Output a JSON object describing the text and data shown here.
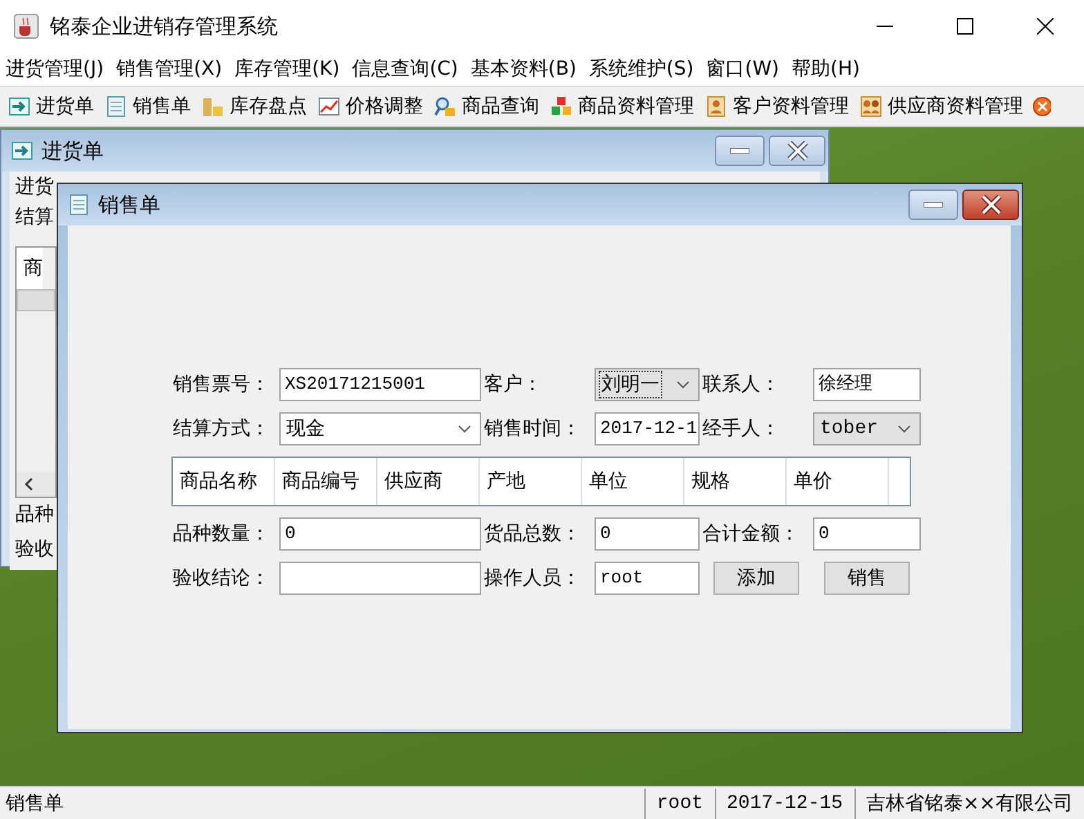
{
  "window": {
    "title": "铭泰企业进销存管理系统"
  },
  "menu": [
    "进货管理(J)",
    "销售管理(X)",
    "库存管理(K)",
    "信息查询(C)",
    "基本资料(B)",
    "系统维护(S)",
    "窗口(W)",
    "帮助(H)"
  ],
  "toolbar": [
    {
      "label": "进货单"
    },
    {
      "label": "销售单"
    },
    {
      "label": "库存盘点"
    },
    {
      "label": "价格调整"
    },
    {
      "label": "商品查询"
    },
    {
      "label": "商品资料管理"
    },
    {
      "label": "客户资料管理"
    },
    {
      "label": "供应商资料管理"
    }
  ],
  "back_frame": {
    "title": "进货单",
    "labels": [
      "进货",
      "结算"
    ],
    "table_header": "商",
    "bottom_labels": [
      "品种",
      "验收"
    ]
  },
  "front_frame": {
    "title": "销售单",
    "top_rows": [
      [
        {
          "kind": "label",
          "text": "销售票号："
        },
        {
          "kind": "field",
          "value": "XS20171215001"
        },
        {
          "kind": "label",
          "text": "客户："
        },
        {
          "kind": "combo",
          "value": "刘明一",
          "focused": true,
          "editable": false
        },
        {
          "kind": "label",
          "text": "联系人："
        },
        {
          "kind": "field",
          "value": "徐经理"
        }
      ],
      [
        {
          "kind": "label",
          "text": "结算方式："
        },
        {
          "kind": "combo",
          "value": "现金",
          "focused": false,
          "editable": true
        },
        {
          "kind": "label",
          "text": "销售时间："
        },
        {
          "kind": "field",
          "value": "2017-12-1"
        },
        {
          "kind": "label",
          "text": "经手人："
        },
        {
          "kind": "combo",
          "value": "tober",
          "focused": false,
          "editable": false
        }
      ]
    ],
    "columns": [
      "商品名称",
      "商品编号",
      "供应商",
      "产地",
      "单位",
      "规格",
      "单价"
    ],
    "bottom_rows": [
      [
        {
          "kind": "label",
          "text": "品种数量："
        },
        {
          "kind": "field",
          "value": "0"
        },
        {
          "kind": "label",
          "text": "货品总数："
        },
        {
          "kind": "field",
          "value": "0"
        },
        {
          "kind": "label",
          "text": "合计金额："
        },
        {
          "kind": "field",
          "value": "0"
        }
      ],
      [
        {
          "kind": "label",
          "text": "验收结论："
        },
        {
          "kind": "field"
        },
        {
          "kind": "label",
          "text": "操作人员："
        },
        {
          "kind": "field",
          "value": "root"
        },
        {
          "kind": "button",
          "text": "添加"
        },
        {
          "kind": "button",
          "text": "销售"
        }
      ]
    ]
  },
  "status_bar": {
    "message": "销售单",
    "user": "root",
    "date": "2017-12-15",
    "company": "吉林省铭泰××有限公司"
  }
}
